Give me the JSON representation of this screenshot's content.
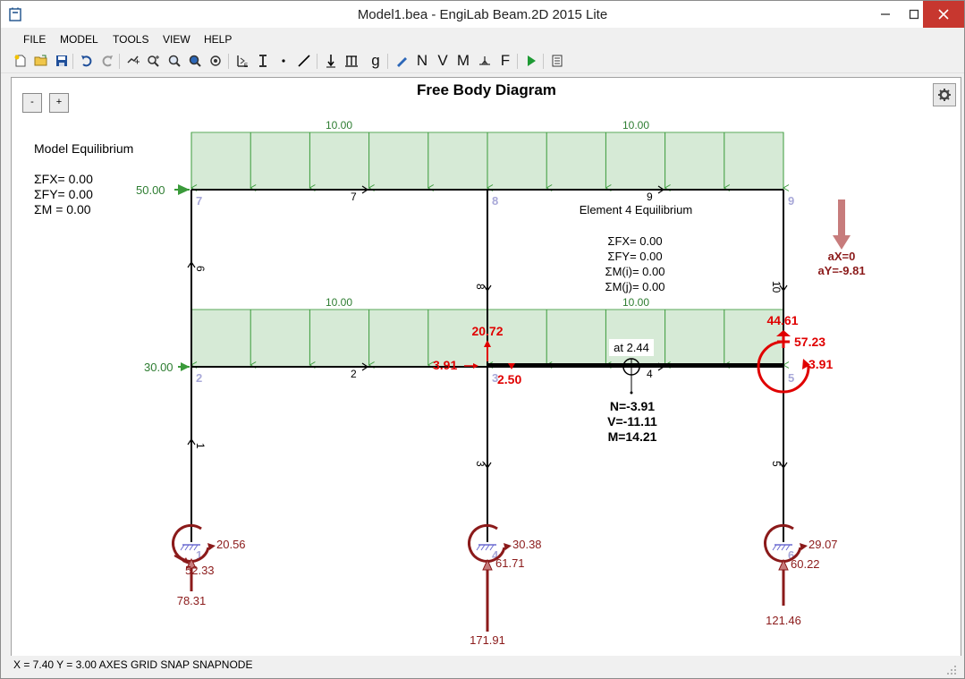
{
  "window": {
    "title": "Model1.bea - EngiLab Beam.2D 2015 Lite"
  },
  "menu": [
    "FILE",
    "MODEL",
    "TOOLS",
    "VIEW",
    "HELP"
  ],
  "toolbar": {
    "icons": [
      "new-file-icon",
      "open-folder-icon",
      "save-icon",
      "undo-icon",
      "redo-icon",
      "zoom-to-fit-icon",
      "zoom-in-out-icon",
      "zoom-window-icon",
      "zoom-all-icon",
      "pan-icon",
      "section-properties-icon",
      "member-properties-icon",
      "node-icon",
      "element-icon",
      "point-load-icon",
      "distributed-load-icon",
      "gravity-icon",
      "pen-icon",
      "N",
      "V",
      "M",
      "supports-icon",
      "F",
      "run-icon",
      "report-icon"
    ],
    "text_buttons": {
      "g": "g",
      "n": "N",
      "v": "V",
      "m": "M",
      "f": "F"
    }
  },
  "zoom": {
    "minus": "-",
    "plus": "+"
  },
  "diagram": {
    "title": "Free Body Diagram",
    "model_equilibrium": {
      "heading": "Model Equilibrium",
      "fx": "ΣFX= 0.00",
      "fy": "ΣFY= 0.00",
      "m": "ΣM = 0.00"
    },
    "element_equilibrium": {
      "heading": "Element 4 Equilibrium",
      "fx": "ΣFX= 0.00",
      "fy": "ΣFY= 0.00",
      "mi": "ΣM(i)= 0.00",
      "mj": "ΣM(j)= 0.00"
    },
    "acceleration": {
      "ax": "aX=0",
      "ay": "aY=-9.81"
    },
    "dist_loads": {
      "top_left": "10.00",
      "top_right": "10.00",
      "mid_left": "10.00",
      "mid_right": "10.00"
    },
    "horizontal_loads": {
      "top": "50.00",
      "mid": "30.00"
    },
    "node_labels": {
      "n1": "1",
      "n2": "2",
      "n3": "3",
      "n4": "4",
      "n5": "5",
      "n6": "6",
      "n7": "7",
      "n8": "8",
      "n9": "9"
    },
    "element_labels": {
      "e1": "1",
      "e2": "2",
      "e3": "3",
      "e4": "4",
      "e5": "5",
      "e6": "6",
      "e7": "7",
      "e8": "8",
      "e9": "9",
      "e10": "10"
    },
    "section_point": {
      "at": "at 2.44",
      "n": "N=-3.91",
      "v": "V=-11.11",
      "m": "M=14.21"
    },
    "element_end_forces": {
      "n3_vertical": "20.72",
      "n3_axial": "3.91",
      "n3_moment": "2.50",
      "n5_vertical": "44.61",
      "n5_moment": "57.23",
      "n5_axial": "3.91"
    },
    "reactions": {
      "n1": {
        "moment": "20.56",
        "horizontal": "52.33",
        "vertical": "78.31"
      },
      "n4": {
        "moment": "30.38",
        "horizontal": "61.71",
        "vertical": "171.91"
      },
      "n6": {
        "moment": "29.07",
        "horizontal": "60.22",
        "vertical": "121.46"
      }
    }
  },
  "status": "X = 7.40  Y = 3.00  AXES  GRID  SNAP  SNAPNODE",
  "colors": {
    "frame": "#000000",
    "dist_load_fill": "#d6ead6",
    "dist_load_arrow": "#3a9a3a",
    "load_text": "#2e7d32",
    "reaction": "#8b1a1a",
    "section_force": "#e00000",
    "node_label": "#a8a8d8"
  }
}
